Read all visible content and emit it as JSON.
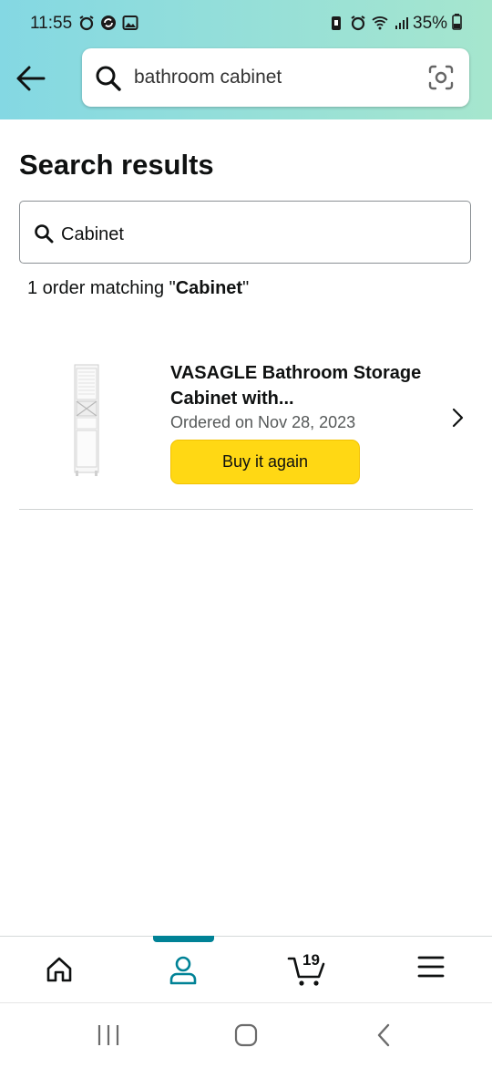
{
  "status_bar": {
    "time": "11:55",
    "battery": "35%"
  },
  "header": {
    "search_query": "bathroom cabinet"
  },
  "page": {
    "title": "Search results",
    "filter_value": "Cabinet",
    "match_prefix": "1 order matching \"",
    "match_term": "Cabinet",
    "match_suffix": "\""
  },
  "orders": [
    {
      "title_line1": "VASAGLE Bathroom Storage",
      "title_line2": "Cabinet with...",
      "ordered_on": "Ordered on Nov 28, 2023",
      "buy_again_label": "Buy it again"
    }
  ],
  "bottom_nav": {
    "cart_count": "19",
    "active_tab": "account",
    "accent_color": "#008296"
  },
  "colors": {
    "header_gradient_start": "#84d8e3",
    "header_gradient_end": "#a6e6ce",
    "buy_button": "#ffd814"
  }
}
